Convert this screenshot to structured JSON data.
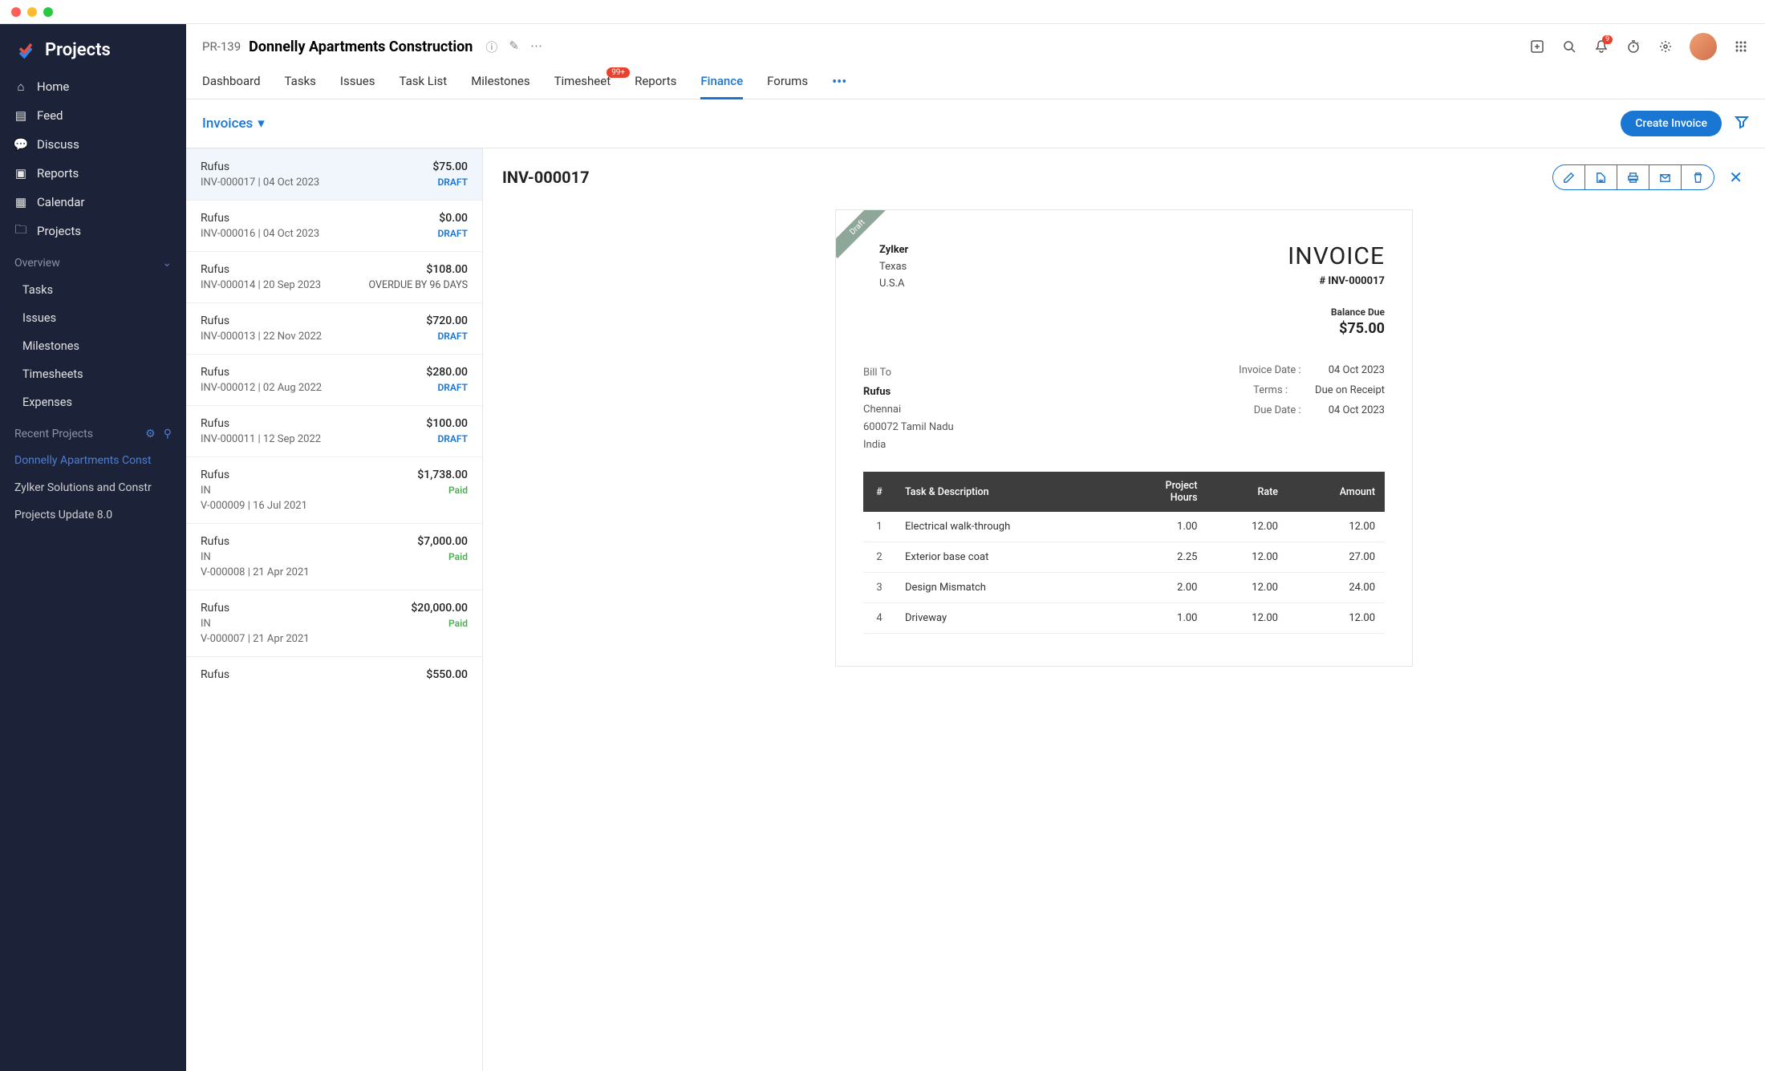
{
  "sidebar": {
    "logo_text": "Projects",
    "items": [
      {
        "label": "Home"
      },
      {
        "label": "Feed"
      },
      {
        "label": "Discuss"
      },
      {
        "label": "Reports"
      },
      {
        "label": "Calendar"
      },
      {
        "label": "Projects"
      }
    ],
    "overview_label": "Overview",
    "overview_items": [
      {
        "label": "Tasks"
      },
      {
        "label": "Issues"
      },
      {
        "label": "Milestones"
      },
      {
        "label": "Timesheets"
      },
      {
        "label": "Expenses"
      }
    ],
    "recent_label": "Recent Projects",
    "recent_items": [
      {
        "label": "Donnelly Apartments Const",
        "active": true
      },
      {
        "label": "Zylker Solutions and Constr",
        "active": false
      },
      {
        "label": "Projects Update 8.0",
        "active": false
      }
    ]
  },
  "header": {
    "project_code": "PR-139",
    "project_title": "Donnelly Apartments Construction",
    "notif_count": "9",
    "tabs": [
      {
        "label": "Dashboard"
      },
      {
        "label": "Tasks"
      },
      {
        "label": "Issues"
      },
      {
        "label": "Task List"
      },
      {
        "label": "Milestones"
      },
      {
        "label": "Timesheet",
        "badge": "99+"
      },
      {
        "label": "Reports"
      },
      {
        "label": "Finance",
        "active": true
      },
      {
        "label": "Forums"
      }
    ]
  },
  "subheader": {
    "dropdown_label": "Invoices",
    "create_button": "Create Invoice"
  },
  "invoices": [
    {
      "name": "Rufus",
      "id": "INV-000017",
      "date": "04 Oct 2023",
      "amount": "$75.00",
      "status": "DRAFT",
      "status_class": "status-draft",
      "selected": true
    },
    {
      "name": "Rufus",
      "id": "INV-000016",
      "date": "04 Oct 2023",
      "amount": "$0.00",
      "status": "DRAFT",
      "status_class": "status-draft"
    },
    {
      "name": "Rufus",
      "id": "INV-000014",
      "date": "20 Sep 2023",
      "amount": "$108.00",
      "status": "OVERDUE BY 96 DAYS",
      "status_class": "status-overdue"
    },
    {
      "name": "Rufus",
      "id": "INV-000013",
      "date": "22 Nov 2022",
      "amount": "$720.00",
      "status": "DRAFT",
      "status_class": "status-draft"
    },
    {
      "name": "Rufus",
      "id": "INV-000012",
      "date": "02 Aug 2022",
      "amount": "$280.00",
      "status": "DRAFT",
      "status_class": "status-draft"
    },
    {
      "name": "Rufus",
      "id": "INV-000011",
      "date": "12 Sep 2022",
      "amount": "$100.00",
      "status": "DRAFT",
      "status_class": "status-draft"
    },
    {
      "name": "Rufus",
      "id_line1": "IN",
      "id": "V-000009",
      "date": "16 Jul 2021",
      "amount": "$1,738.00",
      "status": "Paid",
      "status_class": "status-paid"
    },
    {
      "name": "Rufus",
      "id_line1": "IN",
      "id": "V-000008",
      "date": "21 Apr 2021",
      "amount": "$7,000.00",
      "status": "Paid",
      "status_class": "status-paid"
    },
    {
      "name": "Rufus",
      "id_line1": "IN",
      "id": "V-000007",
      "date": "21 Apr 2021",
      "amount": "$20,000.00",
      "status": "Paid",
      "status_class": "status-paid"
    },
    {
      "name": "Rufus",
      "id": "",
      "date": "",
      "amount": "$550.00",
      "status": "",
      "status_class": ""
    }
  ],
  "detail": {
    "title": "INV-000017",
    "ribbon": "Draft",
    "from_name": "Zylker",
    "from_line1": "Texas",
    "from_line2": "U.S.A",
    "doc_label": "INVOICE",
    "doc_number": "# INV-000017",
    "balance_label": "Balance Due",
    "balance_amount": "$75.00",
    "billto_label": "Bill To",
    "billto_name": "Rufus",
    "billto_line1": "Chennai",
    "billto_line2": "600072 Tamil Nadu",
    "billto_line3": "India",
    "meta": [
      {
        "label": "Invoice Date :",
        "value": "04 Oct 2023"
      },
      {
        "label": "Terms :",
        "value": "Due on Receipt"
      },
      {
        "label": "Due Date :",
        "value": "04 Oct 2023"
      }
    ],
    "table_headers": {
      "num": "#",
      "desc": "Task & Description",
      "hours": "Project Hours",
      "rate": "Rate",
      "amount": "Amount"
    },
    "rows": [
      {
        "num": "1",
        "desc": "Electrical walk-through",
        "hours": "1.00",
        "rate": "12.00",
        "amount": "12.00"
      },
      {
        "num": "2",
        "desc": "Exterior base coat",
        "hours": "2.25",
        "rate": "12.00",
        "amount": "27.00"
      },
      {
        "num": "3",
        "desc": "Design Mismatch",
        "hours": "2.00",
        "rate": "12.00",
        "amount": "24.00"
      },
      {
        "num": "4",
        "desc": "Driveway",
        "hours": "1.00",
        "rate": "12.00",
        "amount": "12.00"
      }
    ]
  }
}
